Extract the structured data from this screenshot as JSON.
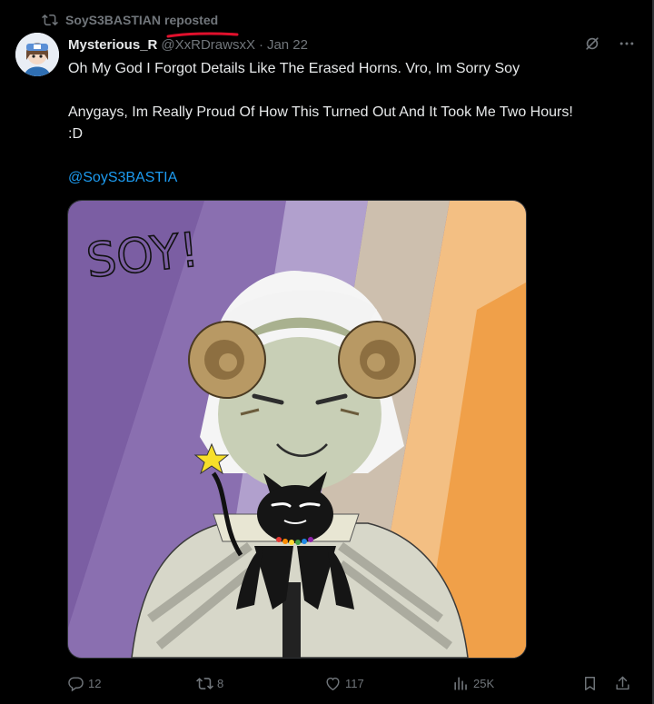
{
  "repost": {
    "icon": "repost-icon",
    "user": "SoyS3BASTIAN",
    "label": "reposted",
    "annotation_color": "#e0102c"
  },
  "author": {
    "display_name": "Mysterious_R",
    "handle": "@XxRDrawsxX",
    "separator": "·",
    "date": "Jan 22"
  },
  "header_actions": [
    {
      "name": "grok-icon"
    },
    {
      "name": "more-icon"
    }
  ],
  "post": {
    "line1": "Oh My God I Forgot Details Like The Erased Horns. Vro, Im Sorry Soy",
    "line2": "Anygays, Im Really Proud Of How This Turned Out And It Took Me Two Hours!",
    "line3": ":D",
    "mention": "@SoyS3BASTIA"
  },
  "media": {
    "lettering": "SOY!",
    "description": "drawing of a white-haired horned character holding a black cat on a striped purple/orange background"
  },
  "actions": {
    "replies": {
      "icon": "reply-icon",
      "count": "12"
    },
    "reposts": {
      "icon": "repost-icon",
      "count": "8"
    },
    "likes": {
      "icon": "heart-icon",
      "count": "117"
    },
    "views": {
      "icon": "views-icon",
      "count": "25K"
    },
    "bookmark": {
      "icon": "bookmark-icon"
    },
    "share": {
      "icon": "share-icon"
    }
  },
  "colors": {
    "background": "#000000",
    "text": "#e7e9ea",
    "muted": "#71767b",
    "link": "#1d9bf0",
    "border": "#2f3336"
  }
}
